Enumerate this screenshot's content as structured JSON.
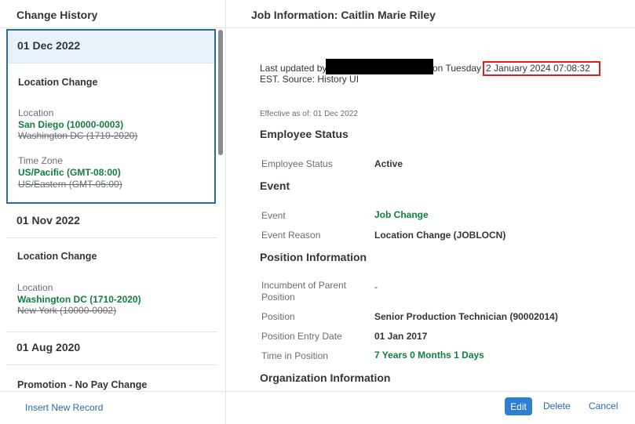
{
  "left_panel": {
    "title": "Change History",
    "insert_link": "Insert New Record",
    "records": [
      {
        "date": "01 Dec 2022",
        "type": "Location Change",
        "changes": [
          {
            "label": "Location",
            "new": "San Diego (10000-0003)",
            "old": "Washington DC (1710-2020)"
          },
          {
            "label": "Time Zone",
            "new": "US/Pacific (GMT-08:00)",
            "old": "US/Eastern (GMT-05:00)"
          }
        ]
      },
      {
        "date": "01 Nov 2022",
        "type": "Location Change",
        "changes": [
          {
            "label": "Location",
            "new": "Washington DC (1710-2020)",
            "old": "New York (10000-0002)"
          }
        ]
      },
      {
        "date": "01 Aug 2020",
        "type": "Promotion - No Pay Change",
        "changes": []
      }
    ]
  },
  "right_panel": {
    "title": "Job Information: Caitlin Marie Riley",
    "last_updated_prefix": "Last updated by",
    "last_updated_on": "on Tuesday",
    "last_updated_datetime": "2 January 2024 07:08:32",
    "last_updated_suffix": "EST. Source: History UI",
    "effective": "Effective as of: 01 Dec 2022",
    "sections": {
      "employee_status": {
        "title": "Employee Status",
        "fields": [
          {
            "label": "Employee Status",
            "value": "Active"
          }
        ]
      },
      "event": {
        "title": "Event",
        "fields": [
          {
            "label": "Event",
            "value": "Job Change"
          },
          {
            "label": "Event Reason",
            "value": "Location Change (JOBLOCN)"
          }
        ]
      },
      "position": {
        "title": "Position Information",
        "fields": [
          {
            "label": "Incumbent of Parent Position",
            "value": "-"
          },
          {
            "label": "Position",
            "value": "Senior Production Technician (90002014)"
          },
          {
            "label": "Position Entry Date",
            "value": "01 Jan 2017"
          },
          {
            "label": "Time in Position",
            "value": "7 Years 0 Months 1 Days"
          }
        ]
      },
      "organization": {
        "title": "Organization Information"
      }
    },
    "buttons": {
      "edit": "Edit",
      "delete": "Delete",
      "cancel": "Cancel"
    }
  },
  "colors": {
    "accent": "#2f7fd0",
    "highlight_box": "#e0201e",
    "new_value": "#107e3e",
    "selection_border": "#2e6a9b"
  }
}
